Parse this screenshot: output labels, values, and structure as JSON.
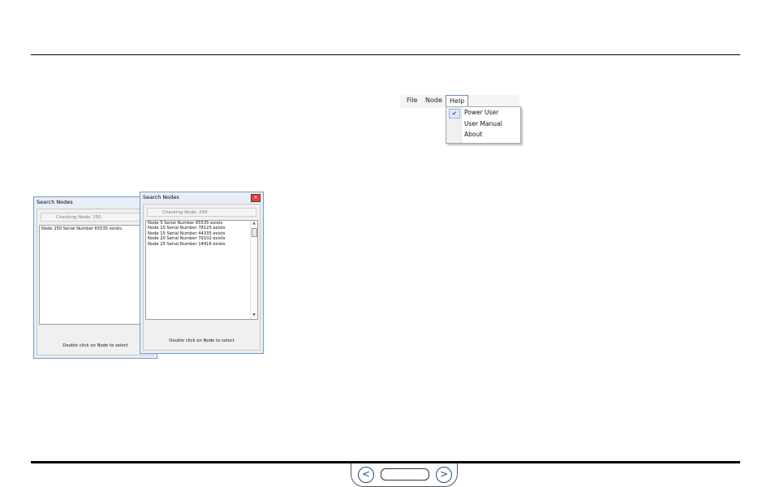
{
  "menu": {
    "items": [
      "File",
      "Node",
      "Help"
    ],
    "help_dropdown": [
      {
        "label": "Power User",
        "checked": true
      },
      {
        "label": "User Manual",
        "checked": false
      },
      {
        "label": "About",
        "checked": false
      }
    ],
    "check_icon": "checkmark-icon"
  },
  "window_back": {
    "title": "Search Nodes",
    "status": "Checking Node: 250",
    "list": [
      "Node 250 Serial Number 65535 exists."
    ],
    "footer": "Double click on Node to select"
  },
  "window_front": {
    "title": "Search Nodes",
    "close_icon": "close-icon",
    "status": "Checking Node: 250",
    "list": [
      "Node 5 Serial Number 65535 exists",
      "Node 10 Serial Number 78125 exists",
      "Node 15 Serial Number 44335 exists",
      "Node 20 Serial Number 79102 exists",
      "Node 25 Serial Number 14416 exists"
    ],
    "footer": "Double click on Node to select"
  },
  "navigation": {
    "prev_icon": "chevron-left-icon",
    "next_icon": "chevron-right-icon",
    "prev_glyph": "<",
    "next_glyph": ">"
  },
  "colors": {
    "accent": "#1f4e8c",
    "window_border": "#7a9ac8",
    "close_button": "#d9473a"
  }
}
